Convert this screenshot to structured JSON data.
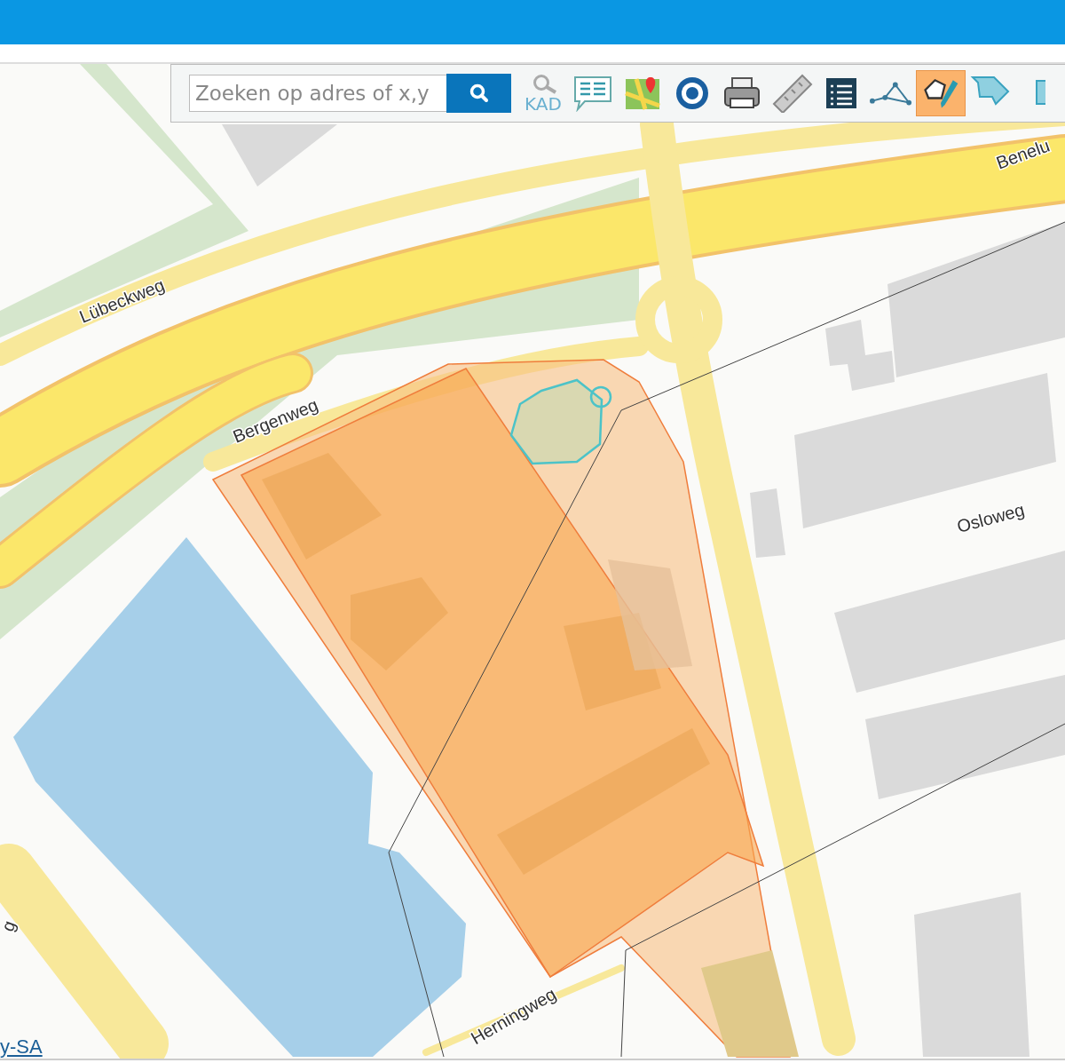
{
  "search": {
    "placeholder": "Zoeken op adres of x,y"
  },
  "tools": [
    {
      "kind": "kad",
      "label": "KAD",
      "selected": false
    },
    {
      "kind": "comment",
      "selected": false
    },
    {
      "kind": "maps",
      "selected": false
    },
    {
      "kind": "target",
      "selected": false
    },
    {
      "kind": "print",
      "selected": false
    },
    {
      "kind": "ruler",
      "selected": false
    },
    {
      "kind": "list",
      "selected": false
    },
    {
      "kind": "vertices",
      "selected": false
    },
    {
      "kind": "draw",
      "selected": true
    },
    {
      "kind": "shape",
      "selected": false
    },
    {
      "kind": "cut",
      "selected": false
    }
  ],
  "map": {
    "labels": [
      "Lübeckweg",
      "Bergenweg",
      "Benelu",
      "Osloweg",
      "Herningweg",
      "g"
    ],
    "attribution": "y-SA"
  }
}
